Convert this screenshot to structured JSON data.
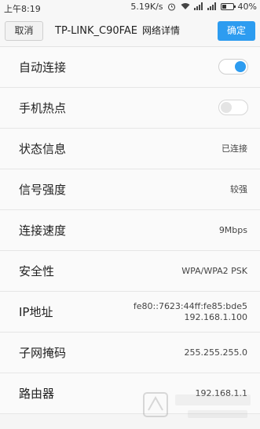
{
  "status_bar": {
    "time": "上午8:19",
    "speed": "5.19K/s",
    "battery": "40%",
    "battery_level": 0.4,
    "icons": [
      "alarm-icon",
      "wifi-icon",
      "signal-icon",
      "signal-icon"
    ]
  },
  "header": {
    "cancel_label": "取消",
    "ssid": "TP-LINK_C90FAE",
    "subtitle": "网络详情",
    "confirm_label": "确定"
  },
  "rows": [
    {
      "label": "自动连接",
      "toggle": true
    },
    {
      "label": "手机热点",
      "toggle": false
    },
    {
      "label": "状态信息",
      "value": "已连接"
    },
    {
      "label": "信号强度",
      "value": "较强"
    },
    {
      "label": "连接速度",
      "value": "9Mbps"
    },
    {
      "label": "安全性",
      "value": "WPA/WPA2 PSK"
    },
    {
      "label": "IP地址",
      "value": "fe80::7623:44ff:fe85:bde5",
      "value2": "192.168.1.100"
    },
    {
      "label": "子网掩码",
      "value": "255.255.255.0"
    },
    {
      "label": "路由器",
      "value": "192.168.1.1"
    }
  ],
  "colors": {
    "accent": "#2d9cf0",
    "background": "#fafafa"
  }
}
